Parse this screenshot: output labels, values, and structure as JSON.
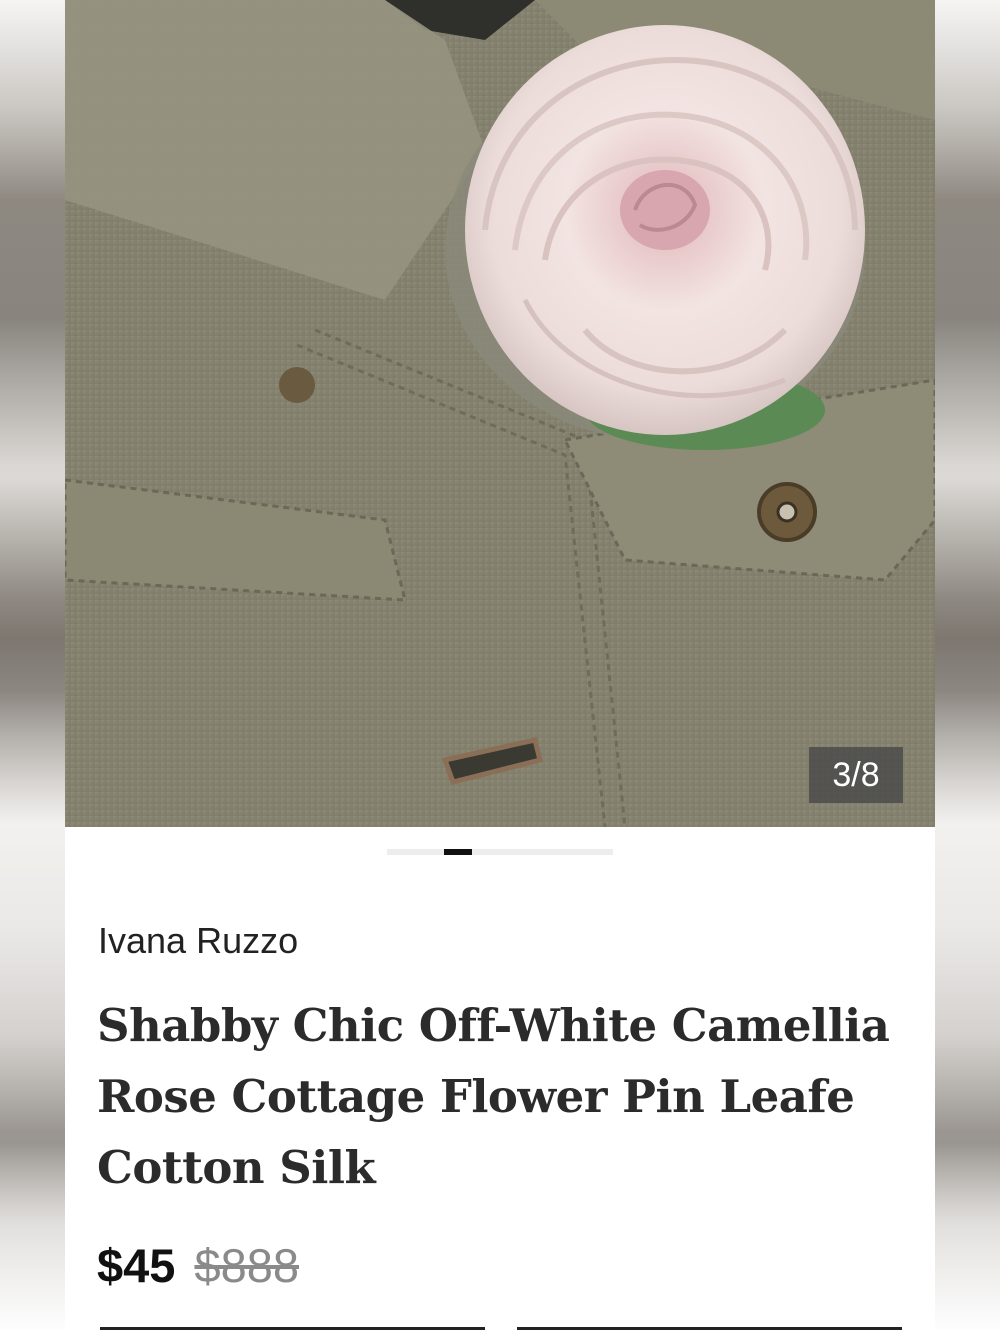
{
  "gallery": {
    "counter": "3/8",
    "image_alt": "Pink cotton silk rose pin on a denim jacket"
  },
  "listing": {
    "seller": "Ivana Ruzzo",
    "title": "Shabby Chic Off-White Camellia Rose Cottage Flower Pin Leafe Cotton Silk",
    "price": "$45",
    "original_price": "$888"
  },
  "colors": {
    "background": "#ffffff",
    "text": "#2b2b2b",
    "strikethrough": "#8a8a8a",
    "denim": "#8a876f",
    "rose": "#efdfdc"
  }
}
